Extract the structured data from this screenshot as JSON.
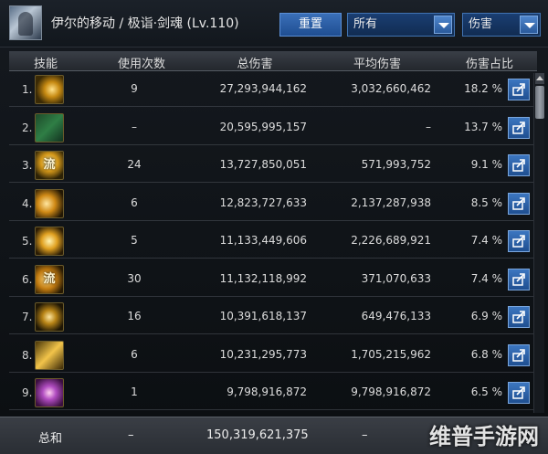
{
  "header": {
    "title": "伊尔的移动 / 极诣·剑魂 (Lv.110)",
    "reset_label": "重置",
    "scope_select": "所有",
    "type_select": "伤害"
  },
  "columns": {
    "skill": "技能",
    "uses": "使用次数",
    "total": "总伤害",
    "avg": "平均伤害",
    "share": "伤害占比"
  },
  "rows": [
    {
      "index": "1.",
      "icon": "slash-skill-icon",
      "glyph": "",
      "uses": "9",
      "total": "27,293,944,162",
      "avg": "3,032,660,462",
      "pct": "18.2 %"
    },
    {
      "index": "2.",
      "icon": "green-sword-skill-icon",
      "glyph": "",
      "uses": "–",
      "total": "20,595,995,157",
      "avg": "–",
      "pct": "13.7 %"
    },
    {
      "index": "3.",
      "icon": "flow-strike-skill-icon",
      "glyph": "流",
      "uses": "24",
      "total": "13,727,850,051",
      "avg": "571,993,752",
      "pct": "9.1 %"
    },
    {
      "index": "4.",
      "icon": "wave-slash-skill-icon",
      "glyph": "",
      "uses": "6",
      "total": "12,823,727,633",
      "avg": "2,137,287,938",
      "pct": "8.5 %"
    },
    {
      "index": "5.",
      "icon": "burst-slash-skill-icon",
      "glyph": "",
      "uses": "5",
      "total": "11,133,449,606",
      "avg": "2,226,689,921",
      "pct": "7.4 %"
    },
    {
      "index": "6.",
      "icon": "flow-crescent-skill-icon",
      "glyph": "流",
      "uses": "30",
      "total": "11,132,118,992",
      "avg": "371,070,633",
      "pct": "7.4 %"
    },
    {
      "index": "7.",
      "icon": "crescent-skill-icon",
      "glyph": "",
      "uses": "16",
      "total": "10,391,618,137",
      "avg": "649,476,133",
      "pct": "6.9 %"
    },
    {
      "index": "8.",
      "icon": "blade-rain-skill-icon",
      "glyph": "",
      "uses": "6",
      "total": "10,231,295,773",
      "avg": "1,705,215,962",
      "pct": "6.8 %"
    },
    {
      "index": "9.",
      "icon": "purple-burst-skill-icon",
      "glyph": "",
      "uses": "1",
      "total": "9,798,916,872",
      "avg": "9,798,916,872",
      "pct": "6.5 %"
    }
  ],
  "total": {
    "label": "总和",
    "uses": "–",
    "total": "150,319,621,375",
    "avg": "–"
  },
  "watermark": "维普手游网"
}
